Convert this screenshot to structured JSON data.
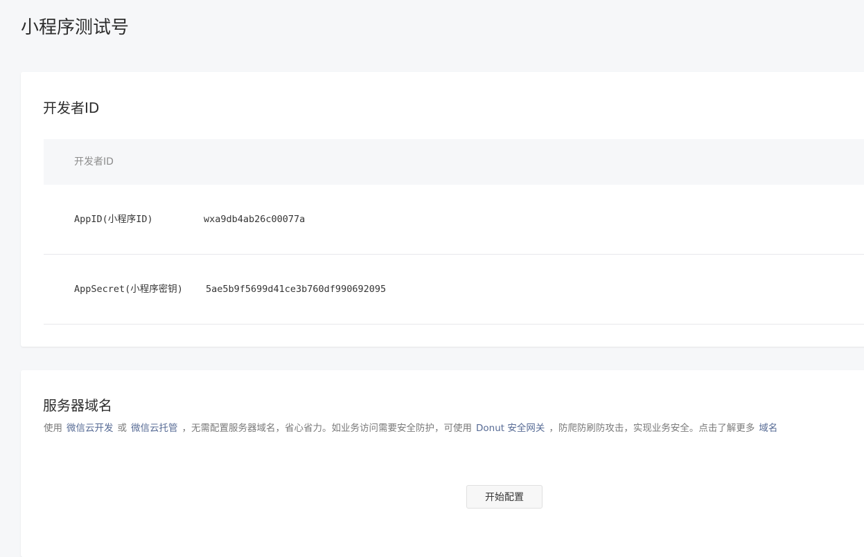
{
  "page": {
    "title": "小程序测试号"
  },
  "developer": {
    "section_title": "开发者ID",
    "table_header": "开发者ID",
    "rows": [
      {
        "label": "AppID(小程序ID)",
        "value": "wxa9db4ab26c00077a"
      },
      {
        "label": "AppSecret(小程序密钥)",
        "value": "5ae5b9f5699d41ce3b760df990692095"
      }
    ]
  },
  "server": {
    "section_title": "服务器域名",
    "desc": {
      "p1": "使用",
      "link1": "微信云开发",
      "p2": "或",
      "link2": "微信云托管",
      "p3": "，无需配置服务器域名，省心省力。如业务访问需要安全防护，可使用",
      "link3": "Donut 安全网关",
      "p4": "，防爬防刷防攻击，实现业务安全。点击了解更多",
      "link4": "域名"
    },
    "start_button": "开始配置"
  },
  "colors": {
    "background": "#f6f7f9",
    "card": "#ffffff",
    "link": "#576b95",
    "muted_text": "#8c8c8c"
  }
}
